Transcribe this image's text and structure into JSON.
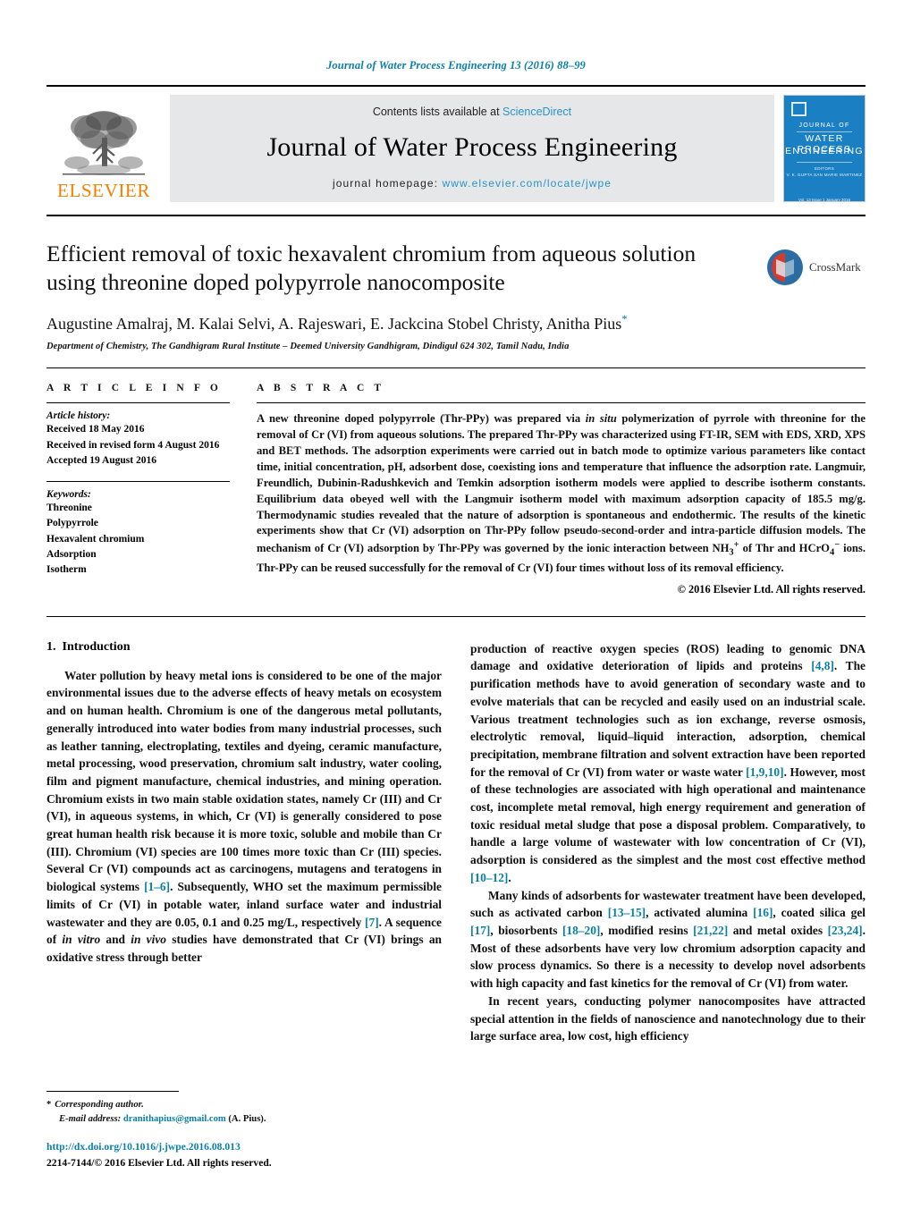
{
  "running_head": "Journal of Water Process Engineering 13 (2016) 88–99",
  "masthead": {
    "publisher_name": "ELSEVIER",
    "contents_prefix": "Contents lists available at ",
    "contents_link": "ScienceDirect",
    "journal_title": "Journal of Water Process Engineering",
    "homepage_prefix": "journal homepage: ",
    "homepage_url": "www.elsevier.com/locate/jwpe",
    "cover": {
      "line1": "JOURNAL OF",
      "line2": "WATER PROCESS",
      "line3": "ENGINEERING",
      "editors_label": "EDITORS",
      "editors": "V. K. GUPTA    SAN MARIE MARTINEZ",
      "footer": "Vol. 13  Issue 1  January 2016"
    }
  },
  "article": {
    "title": "Efficient removal of toxic hexavalent chromium from aqueous solution using threonine doped polypyrrole nanocomposite",
    "authors": "Augustine Amalraj, M. Kalai Selvi, A. Rajeswari, E. Jackcina Stobel Christy, Anitha Pius",
    "corresponding_marker": "*",
    "affiliation": "Department of Chemistry, The Gandhigram Rural Institute – Deemed University Gandhigram, Dindigul 624 302, Tamil Nadu, India",
    "crossmark_label": "CrossMark"
  },
  "article_info": {
    "heading": "A R T I C L E   I N F O",
    "history_heading": "Article history:",
    "history": [
      "Received 18 May 2016",
      "Received in revised form 4 August 2016",
      "Accepted 19 August 2016"
    ],
    "keywords_heading": "Keywords:",
    "keywords": [
      "Threonine",
      "Polypyrrole",
      "Hexavalent chromium",
      "Adsorption",
      "Isotherm"
    ]
  },
  "abstract": {
    "heading": "A B S T R A C T",
    "part1": "A new threonine doped polypyrrole (Thr-PPy) was prepared via ",
    "insitu": "in situ",
    "part2": " polymerization of pyrrole with threonine for the removal of Cr (VI) from aqueous solutions. The prepared Thr-PPy was characterized using FT-IR, SEM with EDS, XRD, XPS and BET methods. The adsorption experiments were carried out in batch mode to optimize various parameters like contact time, initial concentration, pH, adsorbent dose, coexisting ions and temperature that influence the adsorption rate. Langmuir, Freundlich, Dubinin-Radushkevich and Temkin adsorption isotherm models were applied to describe isotherm constants. Equilibrium data obeyed well with the Langmuir isotherm model with maximum adsorption capacity of 185.5 mg/g. Thermodynamic studies revealed that the nature of adsorption is spontaneous and endothermic. The results of the kinetic experiments show that Cr (VI) adsorption on Thr-PPy follow pseudo-second-order and intra-particle diffusion models. The mechanism of Cr (VI) adsorption by Thr-PPy was governed by the ionic interaction between NH",
    "sub3": "3",
    "sup_plus": "+",
    "part3": " of Thr and HCrO",
    "sub4": "4",
    "sup_minus": "−",
    "part4": " ions. Thr-PPy can be reused successfully for the removal of Cr (VI) four times without loss of its removal efficiency.",
    "copyright": "© 2016 Elsevier Ltd. All rights reserved."
  },
  "introduction": {
    "number": "1.",
    "heading": "Introduction",
    "left_para": {
      "t1": "Water pollution by heavy metal ions is considered to be one of the major environmental issues due to the adverse effects of heavy metals on ecosystem and on human health. Chromium is one of the dangerous metal pollutants, generally introduced into water bodies from many industrial processes, such as leather tanning, electroplating, textiles and dyeing, ceramic manufacture, metal processing, wood preservation, chromium salt industry, water cooling, film and pigment manufacture, chemical industries, and mining operation. Chromium exists in two main stable oxidation states, namely Cr (III) and Cr (VI), in aqueous systems, in which, Cr (VI) is generally considered to pose great human health risk because it is more toxic, soluble and mobile than Cr (III). Chromium (VI) species are 100 times more toxic than Cr (III) species. Several Cr (VI) compounds act as carcinogens, mutagens and teratogens in biological systems ",
      "c1": "[1–6]",
      "t2": ". Subsequently, WHO set the maximum permissible limits of Cr (VI) in potable water, inland surface water and industrial wastewater and they are 0.05, 0.1 and 0.25 mg/L, respectively ",
      "c2": "[7]",
      "t3": ". A sequence of ",
      "i1": "in vitro",
      "t4": " and ",
      "i2": "in vivo",
      "t5": " studies have demonstrated that Cr (VI) brings an oxidative stress through better"
    },
    "right_para1": {
      "t1": "production of reactive oxygen species (ROS) leading to genomic DNA damage and oxidative deterioration of lipids and proteins ",
      "c1": "[4,8]",
      "t2": ". The purification methods have to avoid generation of secondary waste and to evolve materials that can be recycled and easily used on an industrial scale. Various treatment technologies such as ion exchange, reverse osmosis, electrolytic removal, liquid–liquid interaction, adsorption, chemical precipitation, membrane filtration and solvent extraction have been reported for the removal of Cr (VI) from water or waste water ",
      "c2": "[1,9,10]",
      "t3": ". However, most of these technologies are associated with high operational and maintenance cost, incomplete metal removal, high energy requirement and generation of toxic residual metal sludge that pose a disposal problem. Comparatively, to handle a large volume of wastewater with low concentration of Cr (VI), adsorption is considered as the simplest and the most cost effective method ",
      "c3": "[10–12]",
      "t4": "."
    },
    "right_para2": {
      "t1": "Many kinds of adsorbents for wastewater treatment have been developed, such as activated carbon ",
      "c1": "[13–15]",
      "t2": ", activated alumina ",
      "c2": "[16]",
      "t3": ", coated silica gel ",
      "c3": "[17]",
      "t4": ", biosorbents ",
      "c4": "[18–20]",
      "t5": ", modified resins ",
      "c5": "[21,22]",
      "t6": " and metal oxides ",
      "c6": "[23,24]",
      "t7": ". Most of these adsorbents have very low chromium adsorption capacity and slow process dynamics. So there is a necessity to develop novel adsorbents with high capacity and fast kinetics for the removal of Cr (VI) from water."
    },
    "right_para3": {
      "t1": "In recent years, conducting polymer nanocomposites have attracted special attention in the fields of nanoscience and nanotechnology due to their large surface area, low cost, high efficiency"
    }
  },
  "footer": {
    "corresponding_marker": "*",
    "corresponding_label": "Corresponding author.",
    "email_label": "E-mail address:",
    "email": "dranithapius@gmail.com",
    "email_suffix": "(A. Pius).",
    "doi": "http://dx.doi.org/10.1016/j.jwpe.2016.08.013",
    "issn_line": "2214-7144/© 2016 Elsevier Ltd. All rights reserved."
  },
  "colors": {
    "link_blue": "#0b7fa8",
    "science_direct_blue": "#2a93c9",
    "elsevier_orange": "#F08000",
    "cover_blue": "#1b7fc4"
  }
}
